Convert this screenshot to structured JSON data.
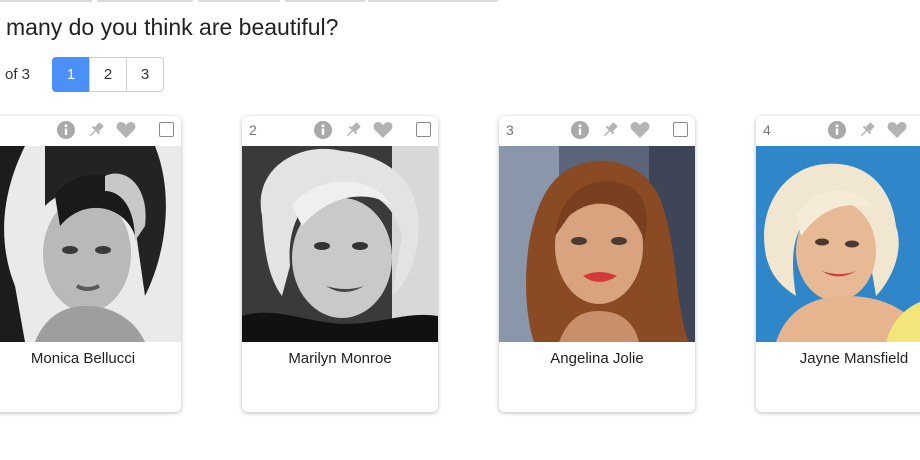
{
  "question": "many do you think are beautiful?",
  "pagination": {
    "label": "of 3",
    "pages": [
      "1",
      "2",
      "3"
    ],
    "current": "1",
    "accent_color": "#4a90f7"
  },
  "cards": [
    {
      "number": "",
      "name": "Monica Bellucci",
      "photo_style": "black-and-white portrait",
      "icons": [
        "info-icon",
        "pin-icon",
        "heart-icon"
      ]
    },
    {
      "number": "2",
      "name": "Marilyn Monroe",
      "photo_style": "black-and-white portrait",
      "icons": [
        "info-icon",
        "pin-icon",
        "heart-icon"
      ]
    },
    {
      "number": "3",
      "name": "Angelina Jolie",
      "photo_style": "color portrait",
      "icons": [
        "info-icon",
        "pin-icon",
        "heart-icon"
      ]
    },
    {
      "number": "4",
      "name": "Jayne Mansfield",
      "photo_style": "color portrait",
      "icons": [
        "info-icon",
        "pin-icon",
        "heart-icon"
      ]
    }
  ]
}
